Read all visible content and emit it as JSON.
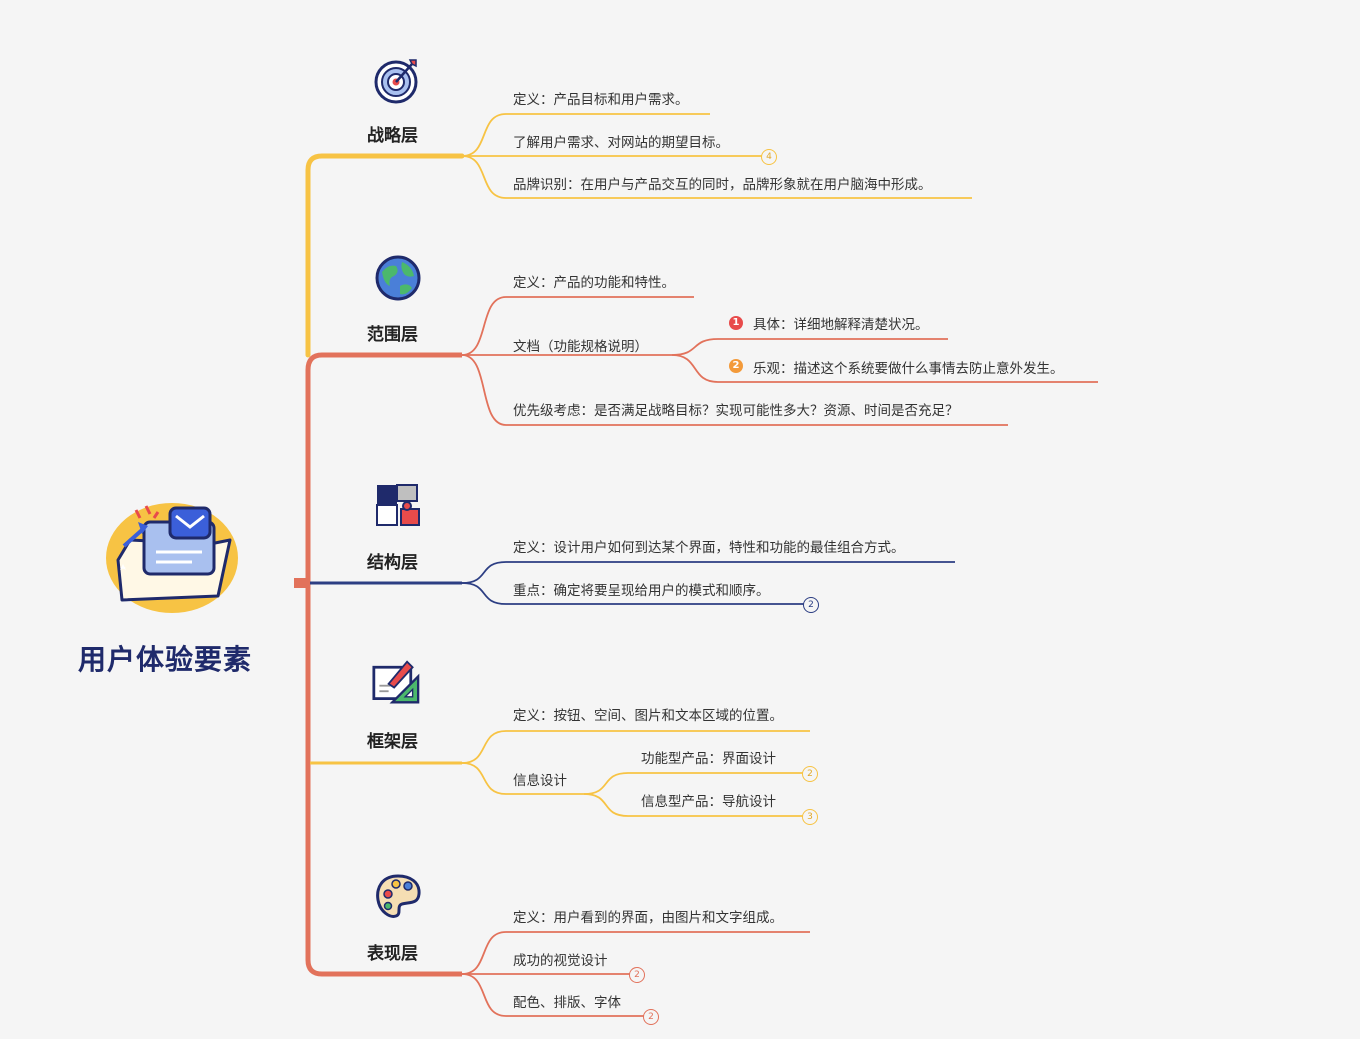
{
  "root": {
    "title": "用户体验要素"
  },
  "branches": [
    {
      "title": "战略层",
      "color": "#f7c344",
      "icon": "target-icon",
      "items": [
        {
          "text": "定义：产品目标和用户需求。"
        },
        {
          "text": "了解用户需求、对网站的期望目标。",
          "count": "4"
        },
        {
          "text": "品牌识别：在用户与产品交互的同时，品牌形象就在用户脑海中形成。"
        }
      ]
    },
    {
      "title": "范围层",
      "color": "#e2725b",
      "icon": "globe-icon",
      "items": [
        {
          "text": "定义：产品的功能和特性。"
        },
        {
          "text": "文档（功能规格说明）",
          "children": [
            {
              "marker": "1",
              "marker_color": "#e84b4b",
              "text": "具体：详细地解释清楚状况。"
            },
            {
              "marker": "2",
              "marker_color": "#f39a3a",
              "text": "乐观：描述这个系统要做什么事情去防止意外发生。"
            }
          ]
        },
        {
          "text": "优先级考虑：是否满足战略目标？实现可能性多大？资源、时间是否充足？"
        }
      ]
    },
    {
      "title": "结构层",
      "color": "#2c3e83",
      "icon": "puzzle-icon",
      "items": [
        {
          "text": "定义：设计用户如何到达某个界面，特性和功能的最佳组合方式。"
        },
        {
          "text": "重点：确定将要呈现给用户的模式和顺序。",
          "count": "2"
        }
      ]
    },
    {
      "title": "框架层",
      "color": "#f7c344",
      "icon": "sketch-ruler-icon",
      "items": [
        {
          "text": "定义：按钮、空间、图片和文本区域的位置。"
        },
        {
          "text": "信息设计",
          "children": [
            {
              "text": "功能型产品：界面设计",
              "count": "2"
            },
            {
              "text": "信息型产品：导航设计",
              "count": "3"
            }
          ]
        }
      ]
    },
    {
      "title": "表现层",
      "color": "#e2725b",
      "icon": "palette-icon",
      "items": [
        {
          "text": "定义：用户看到的界面，由图片和文字组成。"
        },
        {
          "text": "成功的视觉设计",
          "count": "2"
        },
        {
          "text": "配色、排版、字体",
          "count": "2"
        }
      ]
    }
  ]
}
